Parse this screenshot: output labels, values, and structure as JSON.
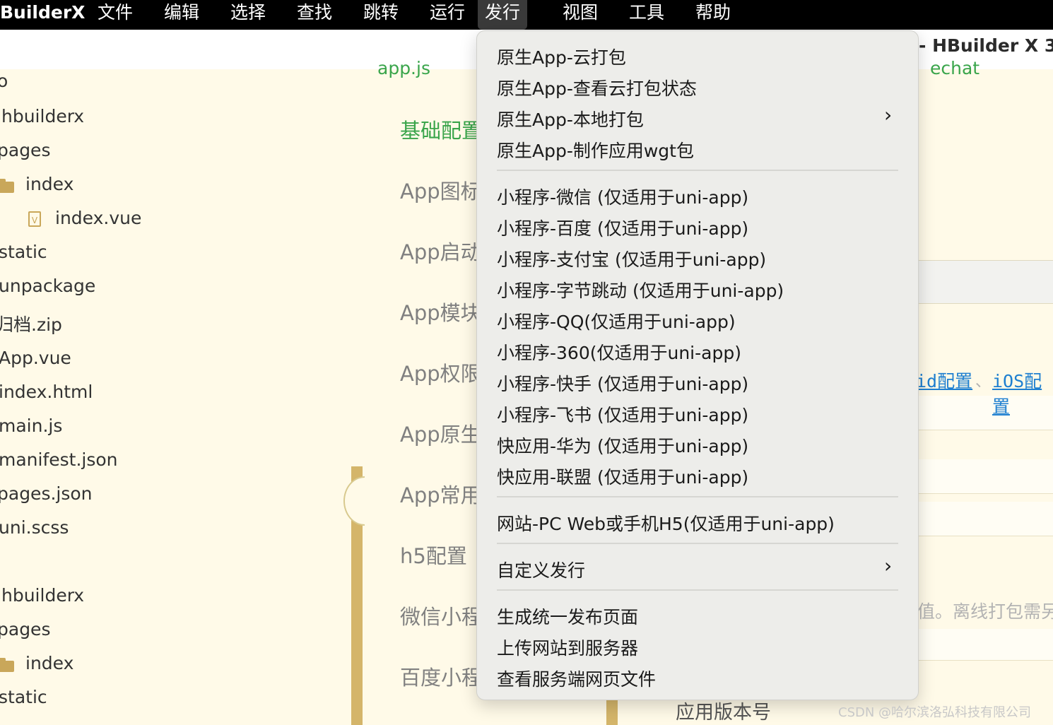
{
  "menubar": {
    "app": "BuilderX",
    "items": [
      "文件",
      "编辑",
      "选择",
      "查找",
      "跳转",
      "运行",
      "发行",
      "视图",
      "工具",
      "帮助"
    ]
  },
  "window_title": "- HBuilder X 3.",
  "sidebar": {
    "items": [
      "o",
      "hbuilderx",
      "pages",
      "index",
      "index.vue",
      "static",
      "unpackage",
      "归档.zip",
      "App.vue",
      "index.html",
      "main.js",
      "manifest.json",
      "pages.json",
      "uni.scss",
      "hbuilderx",
      "pages",
      "index",
      "static"
    ],
    "file_badge": "V"
  },
  "main": {
    "top_left": "app.js",
    "top_right": "echat",
    "config_items": [
      "基础配置",
      "App图标",
      "App启动",
      "App模块",
      "App权限",
      "App原生",
      "App常用",
      "h5配置",
      "微信小程",
      "百度小程"
    ],
    "links": [
      "id配置",
      "iOS配置"
    ],
    "link_sep": "、",
    "hint": "值。离线打包需另",
    "version_label": "应用版本号"
  },
  "dropdown": {
    "group1": [
      "原生App-云打包",
      "原生App-查看云打包状态",
      "原生App-本地打包",
      "原生App-制作应用wgt包"
    ],
    "group2": [
      "小程序-微信 (仅适用于uni-app)",
      "小程序-百度 (仅适用于uni-app)",
      "小程序-支付宝 (仅适用于uni-app)",
      "小程序-字节跳动 (仅适用于uni-app)",
      "小程序-QQ(仅适用于uni-app)",
      "小程序-360(仅适用于uni-app)",
      "小程序-快手 (仅适用于uni-app)",
      "小程序-飞书 (仅适用于uni-app)",
      "快应用-华为 (仅适用于uni-app)",
      "快应用-联盟 (仅适用于uni-app)"
    ],
    "group3": [
      "网站-PC Web或手机H5(仅适用于uni-app)"
    ],
    "group4": [
      "自定义发行"
    ],
    "group5": [
      "生成统一发布页面",
      "上传网站到服务器",
      "查看服务端网页文件"
    ]
  },
  "watermark": "CSDN @哈尔滨洛弘科技有限公司",
  "colors": {
    "accent_green": "#3aa54b",
    "link_blue": "#1e7fd0",
    "folder": "#c9a75a",
    "background": "#fffae8"
  }
}
